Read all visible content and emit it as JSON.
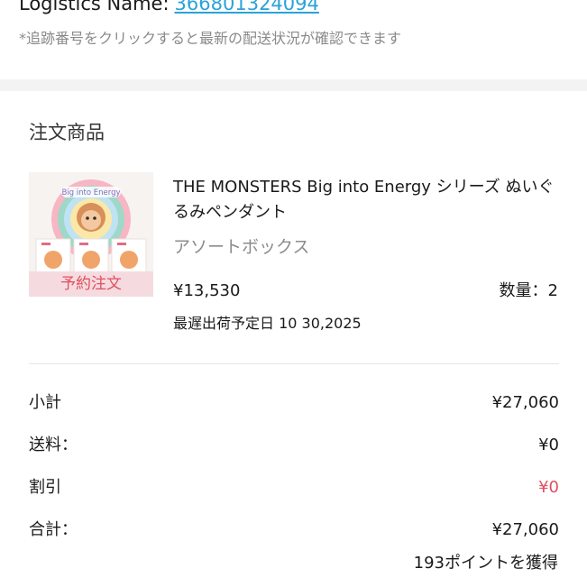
{
  "logistics": {
    "label": "Logistics Name:",
    "number": "366801324094",
    "note": "*追跡番号をクリックすると最新の配送状況が確認できます"
  },
  "order": {
    "section_title": "注文商品",
    "product": {
      "name": "THE MONSTERS Big into Energy シリーズ ぬいぐるみペンダント",
      "variant": "アソートボックス",
      "badge": "予約注文",
      "box_logo_text": "Big into Energy",
      "price": "¥13,530",
      "quantity": "数量：2",
      "ship_date": "最遅出荷予定日 10 30,2025"
    },
    "summary": [
      {
        "label": "小計",
        "value": "¥27,060"
      },
      {
        "label": "送料：",
        "value": "¥0"
      },
      {
        "label": "割引",
        "value": "¥0"
      },
      {
        "label": "合計：",
        "value": "¥27,060"
      }
    ],
    "points": "193ポイントを獲得"
  },
  "colors": {
    "link": "#2aa3d8",
    "discount": "#e0505f",
    "badge_bg": "#f5dbe0",
    "muted_text": "#8c8c8c",
    "section_gap": "#f3f3f3"
  }
}
